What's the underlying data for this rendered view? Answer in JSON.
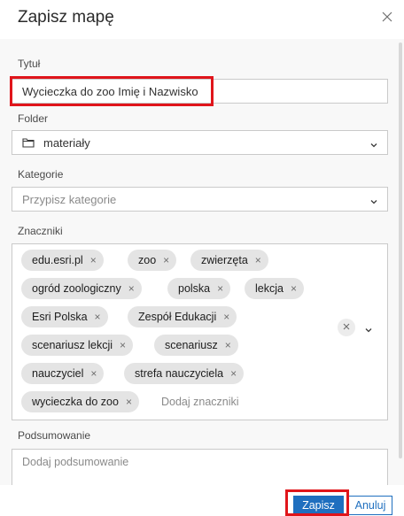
{
  "dialog": {
    "title": "Zapisz mapę",
    "close_icon": "close-icon"
  },
  "fields": {
    "title_label": "Tytuł",
    "title_value": "Wycieczka do zoo Imię i Nazwisko",
    "folder_label": "Folder",
    "folder_value": "materiały",
    "folder_icon": "folder-icon",
    "category_label": "Kategorie",
    "category_placeholder": "Przypisz kategorie",
    "tags_label": "Znaczniki",
    "tags_placeholder": "Dodaj znaczniki",
    "summary_label": "Podsumowanie",
    "summary_placeholder": "Dodaj podsumowanie"
  },
  "tags": [
    "edu.esri.pl",
    "zoo",
    "zwierzęta",
    "ogród zoologiczny",
    "polska",
    "lekcja",
    "Esri Polska",
    "Zespół Edukacji",
    "scenariusz lekcji",
    "scenariusz",
    "nauczyciel",
    "strefa nauczyciela",
    "wycieczka do zoo"
  ],
  "tag_remove_glyph": "×",
  "footer": {
    "save_label": "Zapisz",
    "cancel_label": "Anuluj"
  },
  "colors": {
    "primary": "#1f6fbf",
    "highlight": "#e0151b"
  }
}
